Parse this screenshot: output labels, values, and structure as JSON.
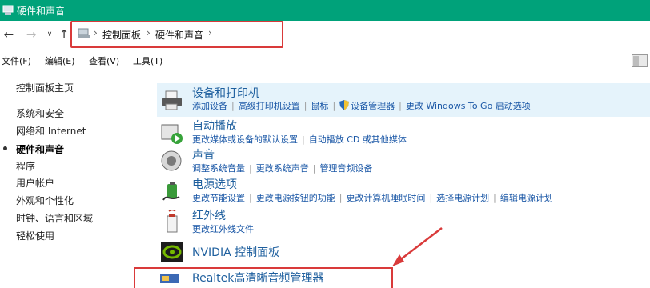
{
  "window": {
    "title": "硬件和声音"
  },
  "nav": {
    "back_icon": "back-arrow-icon",
    "forward_icon": "forward-arrow-icon",
    "recent_icon": "chevron-down-icon",
    "up_icon": "up-arrow-icon",
    "breadcrumb": [
      "控制面板",
      "硬件和声音"
    ]
  },
  "menu": {
    "file": "文件(F)",
    "edit": "编辑(E)",
    "view": "查看(V)",
    "tools": "工具(T)"
  },
  "sidebar": {
    "items": [
      "控制面板主页",
      "系统和安全",
      "网络和 Internet",
      "硬件和声音",
      "程序",
      "用户帐户",
      "外观和个性化",
      "时钟、语言和区域",
      "轻松使用"
    ],
    "current_index": 3
  },
  "categories": [
    {
      "title": "设备和打印机",
      "icon": "printer-icon",
      "links": [
        "添加设备",
        "高级打印机设置",
        "鼠标",
        "设备管理器",
        "更改 Windows To Go 启动选项"
      ]
    },
    {
      "title": "自动播放",
      "icon": "autoplay-icon",
      "links": [
        "更改媒体或设备的默认设置",
        "自动播放 CD 或其他媒体"
      ]
    },
    {
      "title": "声音",
      "icon": "speaker-icon",
      "links": [
        "调整系统音量",
        "更改系统声音",
        "管理音频设备"
      ]
    },
    {
      "title": "电源选项",
      "icon": "power-options-icon",
      "links": [
        "更改节能设置",
        "更改电源按钮的功能",
        "更改计算机睡眠时间",
        "选择电源计划",
        "编辑电源计划"
      ]
    },
    {
      "title": "红外线",
      "icon": "infrared-icon",
      "links": [
        "更改红外线文件"
      ]
    },
    {
      "title": "NVIDIA 控制面板",
      "icon": "nvidia-icon",
      "links": []
    },
    {
      "title": "Realtek高清晰音频管理器",
      "icon": "realtek-audio-icon",
      "links": []
    }
  ],
  "colors": {
    "titlebar": "#00a27a",
    "annotation": "#d93a3a",
    "link": "#1a57a6",
    "hover_row": "#e5f3fb"
  }
}
